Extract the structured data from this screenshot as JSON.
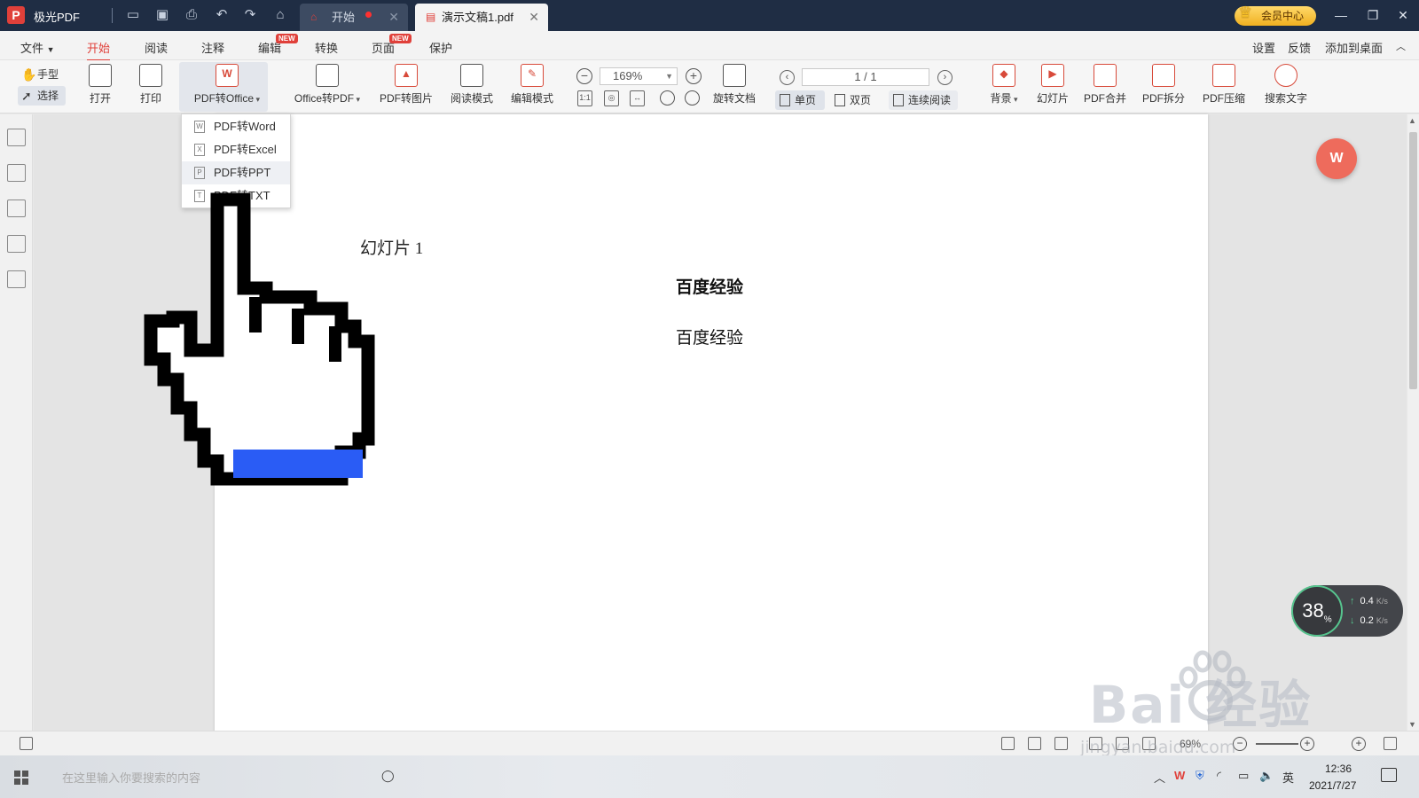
{
  "window": {
    "app_name": "极光PDF",
    "tabs": [
      {
        "label": "开始",
        "active": false
      },
      {
        "label": "演示文稿1.pdf",
        "active": true
      }
    ],
    "vip_label": "会员中心"
  },
  "menubar": {
    "items": [
      {
        "label": "文件"
      },
      {
        "label": "开始",
        "active": true
      },
      {
        "label": "阅读"
      },
      {
        "label": "注释"
      },
      {
        "label": "编辑",
        "badge": "NEW"
      },
      {
        "label": "转换"
      },
      {
        "label": "页面",
        "badge": "NEW"
      },
      {
        "label": "保护"
      }
    ],
    "right_items": [
      "设置",
      "反馈",
      "添加到桌面"
    ]
  },
  "ribbon": {
    "hand": "手型",
    "select": "选择",
    "open": "打开",
    "print": "打印",
    "pdf_to_office": "PDF转Office",
    "office_to_pdf": "Office转PDF",
    "pdf_to_image": "PDF转图片",
    "read_mode": "阅读模式",
    "edit_mode": "编辑模式",
    "zoom": "169%",
    "rotate_doc": "旋转文档",
    "page_indicator": "1 / 1",
    "single_page": "单页",
    "double_page": "双页",
    "continuous": "连续阅读",
    "background": "背景",
    "slideshow": "幻灯片",
    "pdf_merge": "PDF合并",
    "pdf_split": "PDF拆分",
    "pdf_compress": "PDF压缩",
    "search_text": "搜索文字"
  },
  "dropdown": {
    "items": [
      {
        "label": "PDF转Word",
        "icon": "word-file-icon"
      },
      {
        "label": "PDF转Excel",
        "icon": "excel-file-icon"
      },
      {
        "label": "PDF转PPT",
        "icon": "ppt-file-icon",
        "hover": true
      },
      {
        "label": "PDF转TXT",
        "icon": "txt-file-icon"
      }
    ]
  },
  "document": {
    "slide_label": "幻灯片 1",
    "title_bold": "百度经验",
    "title_regular": "百度经验"
  },
  "speed_widget": {
    "percent": "38",
    "percent_unit": "%",
    "upload": "0.4",
    "download": "0.2",
    "unit": "K/s"
  },
  "statusbar": {
    "zoom": "69%"
  },
  "taskbar": {
    "search_placeholder": "在这里输入你要搜索的内容",
    "ime": "英",
    "time": "12:36",
    "date": "2021/7/27"
  },
  "watermark": {
    "brand": "Bai  经验",
    "url": "jingyan.baidu.com"
  },
  "colors": {
    "accent": "#e0403a",
    "titlebar": "#1f2d44",
    "cursor_fill_blue": "#2a5cf5"
  }
}
